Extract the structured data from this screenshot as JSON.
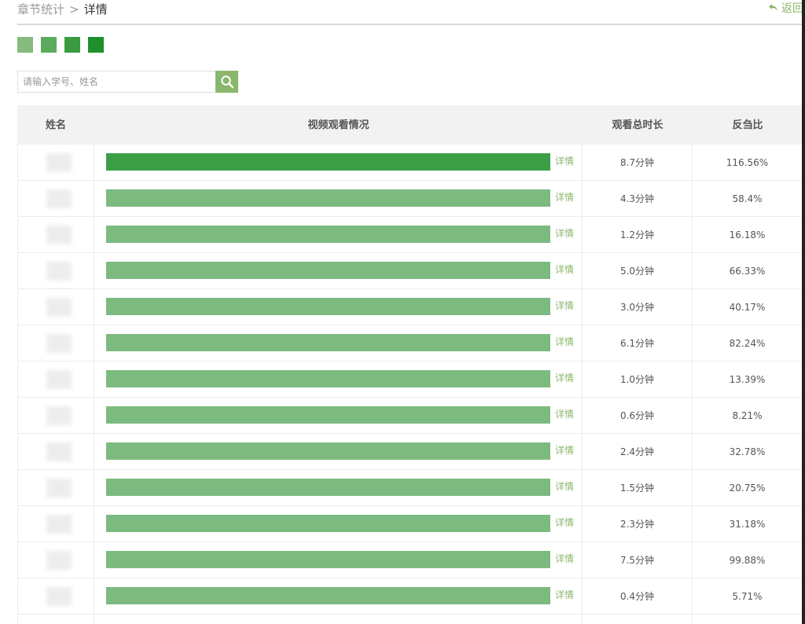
{
  "breadcrumb": {
    "parent": "章节统计",
    "separator": ">",
    "current": "详情"
  },
  "back": {
    "label": "返回"
  },
  "colors": {
    "accent": "#8ab76b",
    "bar_full": "#3c9e46",
    "bar_partial": "#7cba7f",
    "legend": [
      "#85bb7f",
      "#5aab5e",
      "#3a9b40",
      "#1f8f2b"
    ]
  },
  "search": {
    "placeholder": "请输入学号、姓名",
    "value": "",
    "icon": "search-icon"
  },
  "table": {
    "headers": [
      "姓名",
      "视频观看情况",
      "观看总时长",
      "反刍比"
    ],
    "detail_label": "详情",
    "rows": [
      {
        "time": "8.7分钟",
        "ratio": "116.56%",
        "full": true
      },
      {
        "time": "4.3分钟",
        "ratio": "58.4%",
        "full": false
      },
      {
        "time": "1.2分钟",
        "ratio": "16.18%",
        "full": false
      },
      {
        "time": "5.0分钟",
        "ratio": "66.33%",
        "full": false
      },
      {
        "time": "3.0分钟",
        "ratio": "40.17%",
        "full": false
      },
      {
        "time": "6.1分钟",
        "ratio": "82.24%",
        "full": false
      },
      {
        "time": "1.0分钟",
        "ratio": "13.39%",
        "full": false
      },
      {
        "time": "0.6分钟",
        "ratio": "8.21%",
        "full": false
      },
      {
        "time": "2.4分钟",
        "ratio": "32.78%",
        "full": false
      },
      {
        "time": "1.5分钟",
        "ratio": "20.75%",
        "full": false
      },
      {
        "time": "2.3分钟",
        "ratio": "31.18%",
        "full": false
      },
      {
        "time": "7.5分钟",
        "ratio": "99.88%",
        "full": false
      },
      {
        "time": "0.4分钟",
        "ratio": "5.71%",
        "full": false
      }
    ]
  }
}
